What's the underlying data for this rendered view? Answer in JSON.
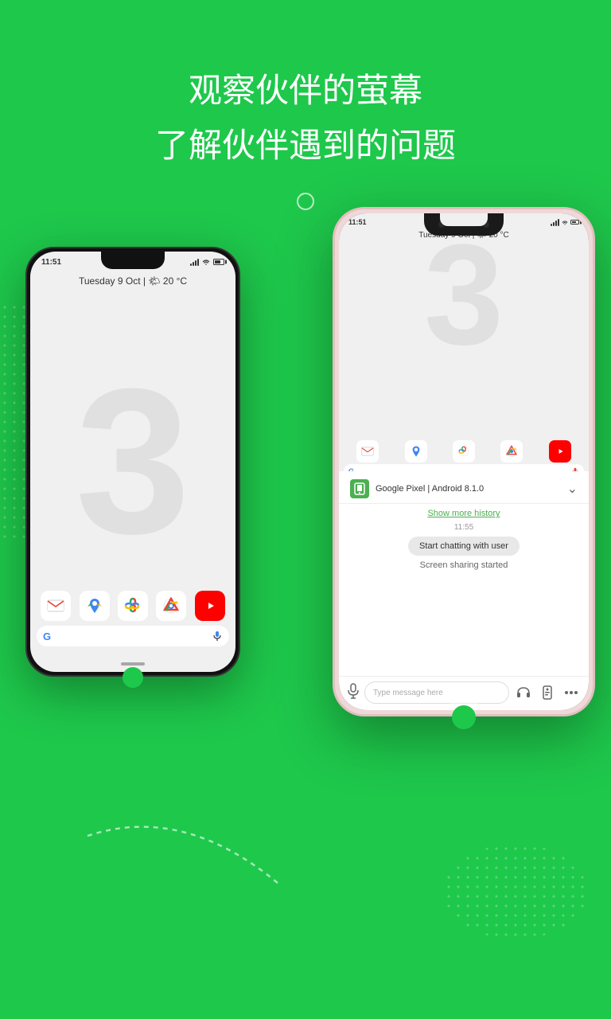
{
  "page": {
    "bg_color": "#1ec84b"
  },
  "title": {
    "line1": "观察伙伴的萤幕",
    "line2": "了解伙伴遇到的问题"
  },
  "phone_left": {
    "time": "11:51",
    "datetime": "Tuesday 9 Oct | 🌤 20 °C",
    "big_number": "3",
    "app_icons": [
      "M",
      "📍",
      "🎨",
      "🌐",
      "▶"
    ],
    "google_text": "G"
  },
  "phone_right": {
    "time": "11:51",
    "datetime": "Tuesday 9 Oct | 🌤 20 °C",
    "big_number": "3",
    "device_info": "Google Pixel | Android 8.1.0",
    "show_history": "Show more history",
    "chat_timestamp": "11:55",
    "chat_bubble": "Start chatting with user",
    "screen_sharing": "Screen sharing started",
    "input_placeholder": "Type message here"
  }
}
